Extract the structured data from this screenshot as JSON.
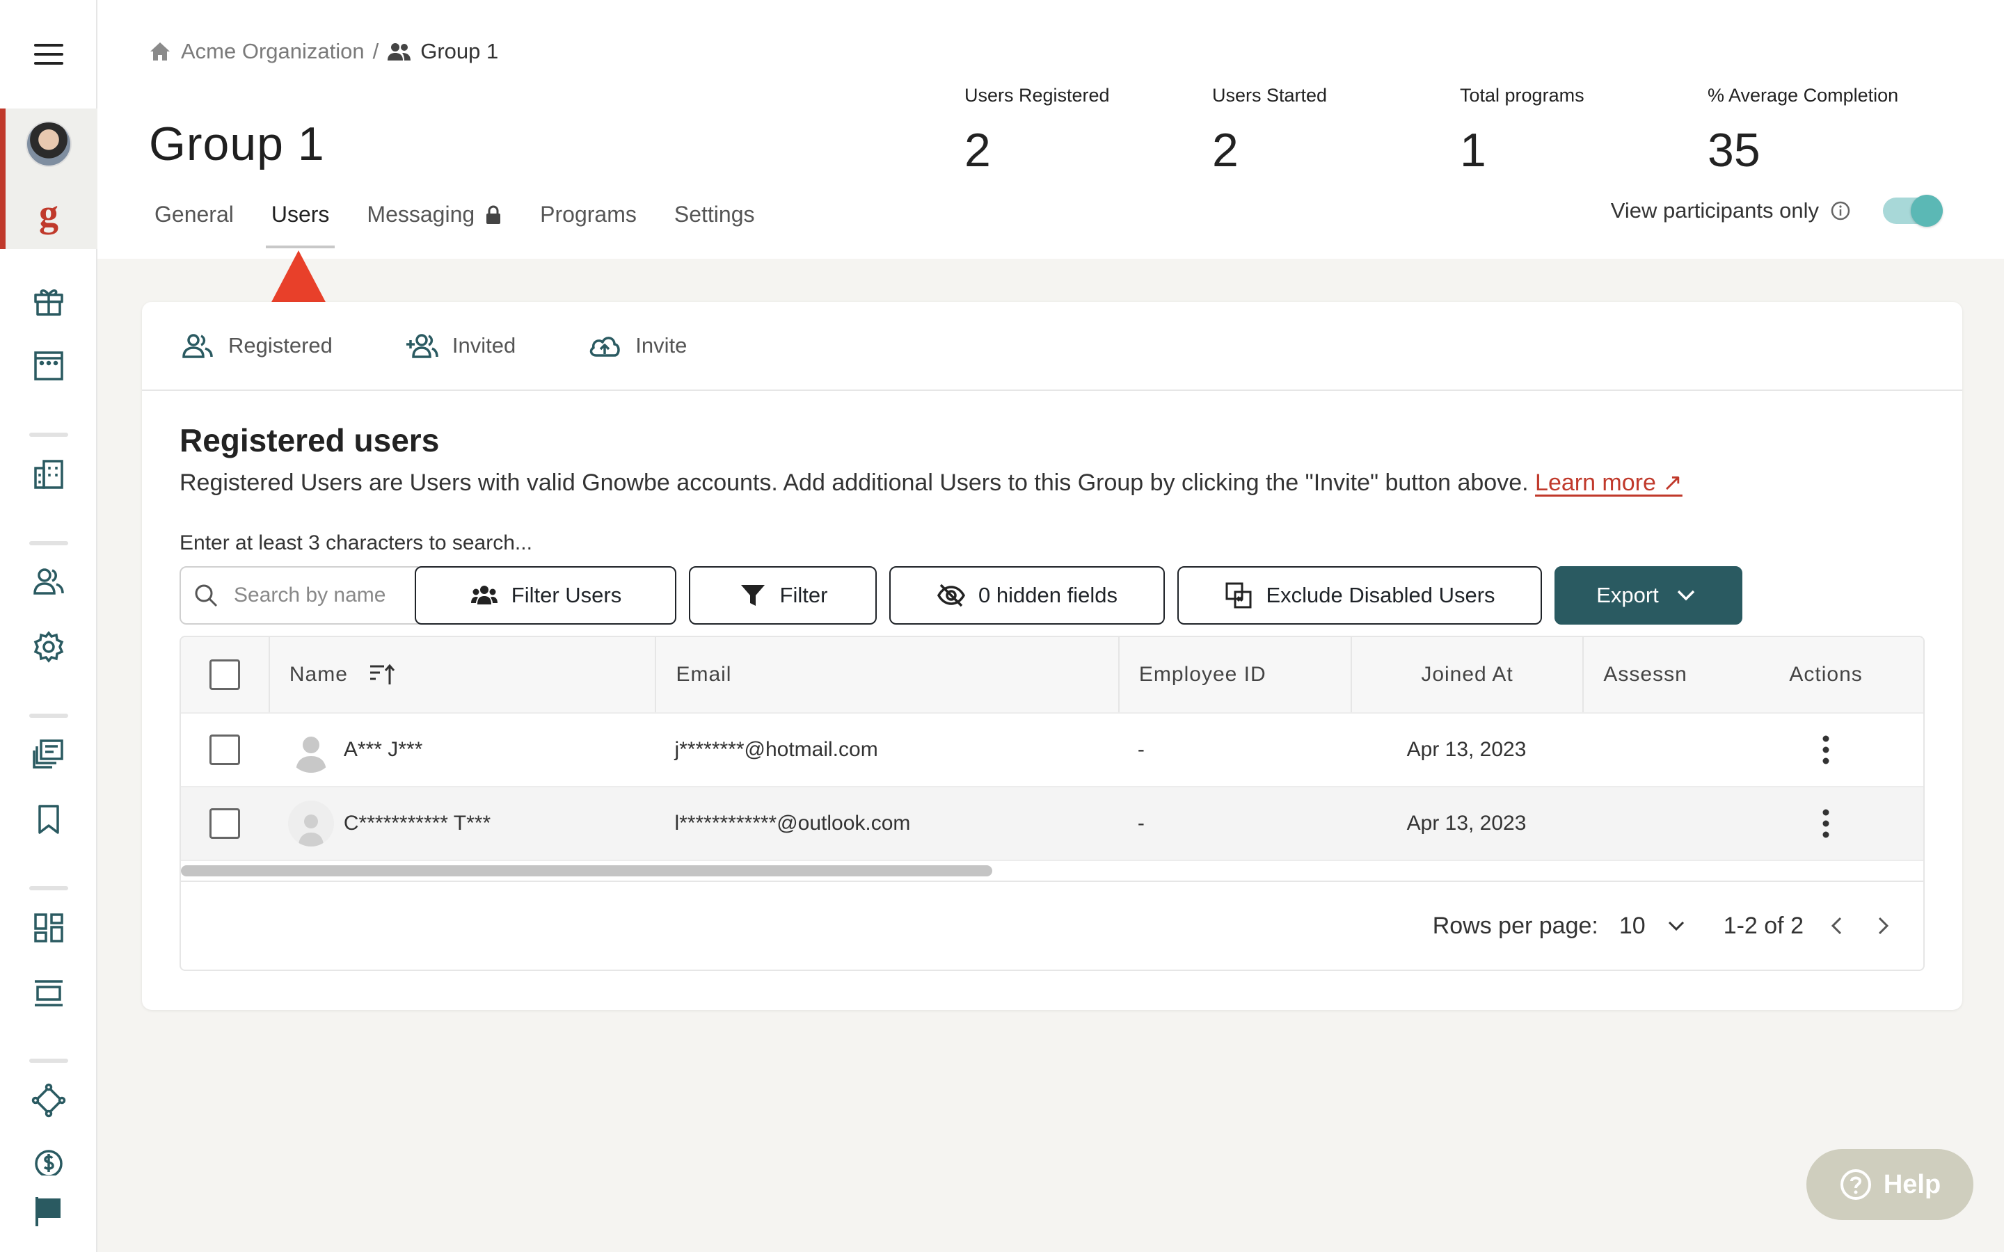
{
  "breadcrumb": {
    "org": "Acme Organization",
    "separator": "/",
    "group": "Group 1"
  },
  "page_title": "Group 1",
  "stats": [
    {
      "label": "Users Registered",
      "value": "2"
    },
    {
      "label": "Users Started",
      "value": "2"
    },
    {
      "label": "Total programs",
      "value": "1"
    },
    {
      "label": "% Average Completion",
      "value": "35"
    }
  ],
  "tabs": [
    {
      "label": "General"
    },
    {
      "label": "Users",
      "active": true
    },
    {
      "label": "Messaging",
      "locked": true
    },
    {
      "label": "Programs"
    },
    {
      "label": "Settings"
    }
  ],
  "view_toggle": {
    "label": "View participants only",
    "on": true
  },
  "subtabs": [
    {
      "label": "Registered",
      "icon": "users-icon"
    },
    {
      "label": "Invited",
      "icon": "add-user-icon"
    },
    {
      "label": "Invite",
      "icon": "cloud-upload-icon"
    }
  ],
  "section": {
    "title": "Registered users",
    "description": "Registered Users are Users with valid Gnowbe accounts. Add additional Users to this Group by clicking the \"Invite\" button above.",
    "learn_more": "Learn more ↗",
    "search_hint": "Enter at least 3 characters to search..."
  },
  "search": {
    "placeholder": "Search by name",
    "value": ""
  },
  "toolbar": {
    "filter_users": "Filter Users",
    "filter": "Filter",
    "hidden_fields": "0 hidden fields",
    "exclude_disabled": "Exclude Disabled Users",
    "export": "Export"
  },
  "table": {
    "headers": {
      "name": "Name",
      "email": "Email",
      "employee_id": "Employee ID",
      "joined_at": "Joined At",
      "assessment": "Assessn",
      "actions": "Actions"
    },
    "rows": [
      {
        "name": "A*** J***",
        "email": "j********@hotmail.com",
        "employee_id": "-",
        "joined_at": "Apr 13, 2023"
      },
      {
        "name": "C*********** T***",
        "email": "l************@outlook.com",
        "employee_id": "-",
        "joined_at": "Apr 13, 2023"
      }
    ]
  },
  "pagination": {
    "rows_per_page_label": "Rows per page:",
    "rows_per_page": "10",
    "range": "1-2 of 2"
  },
  "help": {
    "label": "Help"
  },
  "colors": {
    "accent_red": "#c0392b",
    "export_teal": "#2a5a61",
    "toggle_teal": "#5bb8b5",
    "annotation_arrow": "#e8402a"
  }
}
